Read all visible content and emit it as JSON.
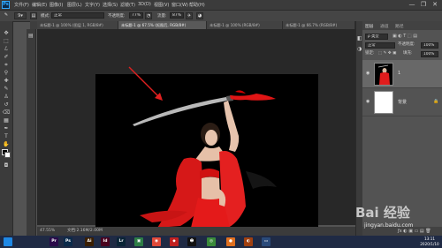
{
  "app": {
    "logo": "Ps"
  },
  "menubar": {
    "items": [
      "文件(F)",
      "编辑(E)",
      "图像(I)",
      "图层(L)",
      "文字(Y)",
      "选择(S)",
      "滤镜(T)",
      "3D(D)",
      "视图(V)",
      "窗口(W)",
      "帮助(H)"
    ],
    "controls": [
      "—",
      "❐",
      "✕"
    ]
  },
  "options": {
    "brush_size": "9",
    "mode_label": "模式:",
    "mode_value": "正常",
    "opacity_label": "不透明度:",
    "opacity_value": "77%",
    "flow_label": "流量:",
    "flow_value": "87%"
  },
  "tabs": [
    {
      "label": "未标题-1 @ 100% (图层 1, RGB/8#)",
      "active": false
    },
    {
      "label": "未标题-1 @ 67.5% (抠图后, RGB/8#)",
      "active": true
    },
    {
      "label": "未标题-1 @ 100% (RGB/8#)",
      "active": false
    },
    {
      "label": "未标题-1 @ 66.7% (RGB/8#)",
      "active": false
    }
  ],
  "status": {
    "zoom": "47.55%",
    "doc": "文档:2.16M/2.00M"
  },
  "panels": {
    "tabs": [
      "图层",
      "通道",
      "路径"
    ],
    "kind_label": "ρ 类型",
    "blend_mode": "正常",
    "opacity_label": "不透明度:",
    "opacity_value": "100%",
    "lock_label": "锁定:",
    "fill_label": "填充:",
    "fill_value": "100%",
    "layers": [
      {
        "name": "1",
        "thumb": "photo",
        "selected": true
      },
      {
        "name": "背景",
        "thumb": "white",
        "selected": false
      }
    ]
  },
  "taskbar": {
    "icons": [
      {
        "name": "windows-start-icon",
        "label": "",
        "color": "#1e88e5"
      },
      {
        "name": "premiere-icon",
        "label": "Pr",
        "color": "#2a0a4a"
      },
      {
        "name": "photoshop-icon",
        "label": "Ps",
        "color": "#0b2a4a"
      },
      {
        "name": "illustrator-icon",
        "label": "Ai",
        "color": "#3a1e00"
      },
      {
        "name": "indesign-icon",
        "label": "Id",
        "color": "#49021f"
      },
      {
        "name": "lightroom-icon",
        "label": "Lr",
        "color": "#0a2436"
      },
      {
        "name": "image-viewer-icon",
        "label": "▣",
        "color": "#2d7d46"
      },
      {
        "name": "colorful-ball-icon",
        "label": "◉",
        "color": "#e04a3a"
      },
      {
        "name": "game-icon",
        "label": "◆",
        "color": "#c02020"
      },
      {
        "name": "qq-penguin-icon",
        "label": "☻",
        "color": "#111111"
      },
      {
        "name": "chrome-icon",
        "label": "◎",
        "color": "#3a8a3a"
      },
      {
        "name": "firefox-icon",
        "label": "●",
        "color": "#e07020"
      },
      {
        "name": "app-icon",
        "label": "◐",
        "color": "#a04010"
      },
      {
        "name": "folder-icon",
        "label": "▭",
        "color": "#2a4a7a"
      }
    ],
    "clock_time": "13:11",
    "clock_date": "2020/1/10"
  },
  "watermark": {
    "text": "Bai 经验",
    "url": "jingyan.baidu.com"
  }
}
